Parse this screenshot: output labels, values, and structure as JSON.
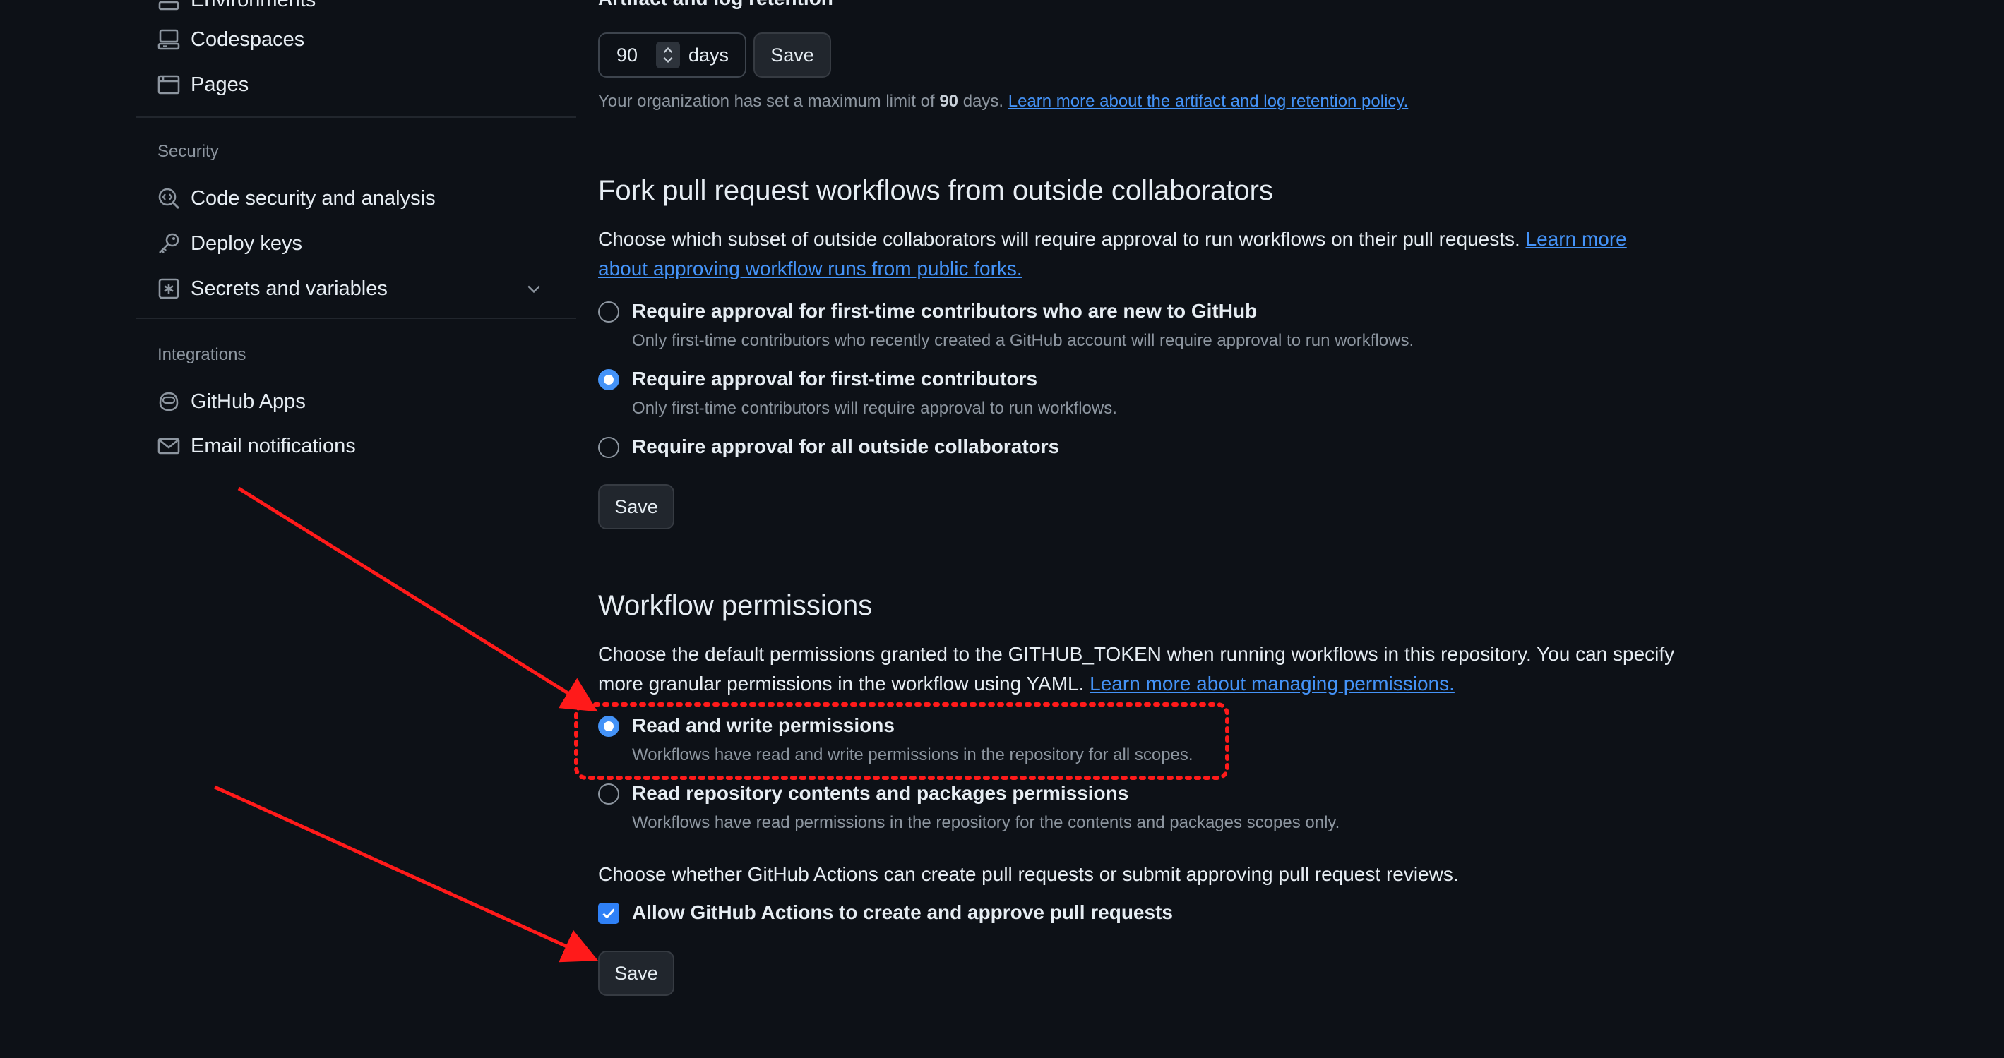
{
  "sidebar": {
    "items_top": [
      {
        "label": "Environments",
        "icon": "server-icon"
      },
      {
        "label": "Codespaces",
        "icon": "codespaces-icon"
      },
      {
        "label": "Pages",
        "icon": "browser-icon"
      }
    ],
    "security_heading": "Security",
    "security_items": [
      {
        "label": "Code security and analysis",
        "icon": "codescan-icon"
      },
      {
        "label": "Deploy keys",
        "icon": "key-icon"
      },
      {
        "label": "Secrets and variables",
        "icon": "asterisk-icon"
      }
    ],
    "integrations_heading": "Integrations",
    "integrations_items": [
      {
        "label": "GitHub Apps",
        "icon": "copilot-icon"
      },
      {
        "label": "Email notifications",
        "icon": "mail-icon"
      }
    ]
  },
  "artifact": {
    "heading": "Artifact and log retention",
    "days_value": "90",
    "days_unit": "days",
    "save_label": "Save",
    "limit_text_prefix": "Your organization has set a maximum limit of ",
    "limit_value": "90",
    "limit_text_suffix": " days. ",
    "policy_link": "Learn more about the artifact and log retention policy."
  },
  "fork": {
    "heading": "Fork pull request workflows from outside collaborators",
    "description": "Choose which subset of outside collaborators will require approval to run workflows on their pull requests. ",
    "link_line1": "Learn more",
    "link_line2": "about approving workflow runs from public forks.",
    "options": [
      {
        "label": "Require approval for first-time contributors who are new to GitHub",
        "desc": "Only first-time contributors who recently created a GitHub account will require approval to run workflows.",
        "checked": false
      },
      {
        "label": "Require approval for first-time contributors",
        "desc": "Only first-time contributors will require approval to run workflows.",
        "checked": true
      },
      {
        "label": "Require approval for all outside collaborators",
        "desc": "",
        "checked": false
      }
    ],
    "save_label": "Save"
  },
  "workflow": {
    "heading": "Workflow permissions",
    "description_line1": "Choose the default permissions granted to the GITHUB_TOKEN when running workflows in this repository. You can specify",
    "description_line2": "more granular permissions in the workflow using YAML. ",
    "link": "Learn more about managing permissions.",
    "options": [
      {
        "label": "Read and write permissions",
        "desc": "Workflows have read and write permissions in the repository for all scopes.",
        "checked": true
      },
      {
        "label": "Read repository contents and packages permissions",
        "desc": "Workflows have read permissions in the repository for the contents and packages scopes only.",
        "checked": false
      }
    ],
    "pr_question": "Choose whether GitHub Actions can create pull requests or submit approving pull request reviews.",
    "allow_label": "Allow GitHub Actions to create and approve pull requests",
    "allow_checked": true,
    "save_label": "Save"
  },
  "colors": {
    "background": "#0d1117",
    "accent": "#4493f8",
    "annotation": "#ff1a1a"
  }
}
